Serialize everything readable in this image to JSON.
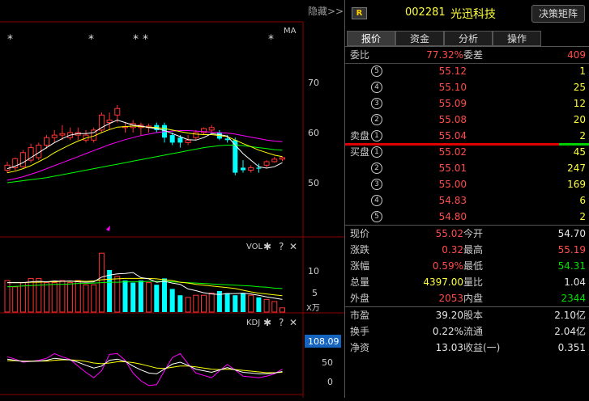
{
  "chart": {
    "hide_label": "隐藏",
    "hide_arrows": ">>",
    "ma_label": "MA",
    "price_ticks": [
      "70",
      "60",
      "50"
    ],
    "vol_label": "VOL",
    "vol_ticks": [
      "10",
      "5"
    ],
    "vol_unit": "X万",
    "kdj_label": "KDJ",
    "kdj_current": "108.09",
    "kdj_ticks": [
      "50",
      "0"
    ],
    "gear_glyph": "✱",
    "help_glyph": "?",
    "close_glyph": "✕",
    "star_glyph": "*",
    "colors": {
      "up": "#ff3333",
      "down": "#00ffff",
      "ma5": "#ffffff",
      "ma10": "#ffff00",
      "ma20": "#ff00ff",
      "ma60": "#00ff00"
    }
  },
  "chart_data": {
    "type": "candlestick",
    "price_ylim": [
      40,
      75
    ],
    "candles": [
      {
        "o": 52.5,
        "h": 54.2,
        "l": 52.0,
        "c": 53.5
      },
      {
        "o": 53.0,
        "h": 55.0,
        "l": 52.5,
        "c": 54.8
      },
      {
        "o": 53.2,
        "h": 56.5,
        "l": 53.0,
        "c": 56.0
      },
      {
        "o": 54.5,
        "h": 57.8,
        "l": 54.0,
        "c": 57.0
      },
      {
        "o": 55.0,
        "h": 58.0,
        "l": 54.5,
        "c": 57.5
      },
      {
        "o": 57.5,
        "h": 59.5,
        "l": 56.8,
        "c": 59.0
      },
      {
        "o": 59.0,
        "h": 60.5,
        "l": 58.0,
        "c": 59.5
      },
      {
        "o": 59.5,
        "h": 61.5,
        "l": 58.5,
        "c": 59.8
      },
      {
        "o": 59.0,
        "h": 61.0,
        "l": 58.5,
        "c": 60.0
      },
      {
        "o": 59.5,
        "h": 61.0,
        "l": 58.5,
        "c": 60.0
      },
      {
        "o": 58.5,
        "h": 60.5,
        "l": 58.0,
        "c": 59.5
      },
      {
        "o": 58.5,
        "h": 61.0,
        "l": 58.0,
        "c": 60.5
      },
      {
        "o": 60.5,
        "h": 64.0,
        "l": 60.0,
        "c": 63.5
      },
      {
        "o": 62.0,
        "h": 64.0,
        "l": 60.5,
        "c": 62.5
      },
      {
        "o": 63.5,
        "h": 65.5,
        "l": 62.0,
        "c": 64.8
      },
      {
        "o": 61.0,
        "h": 62.0,
        "l": 60.0,
        "c": 61.2
      },
      {
        "o": 61.0,
        "h": 62.5,
        "l": 60.0,
        "c": 61.8
      },
      {
        "o": 61.0,
        "h": 62.0,
        "l": 59.5,
        "c": 61.5
      },
      {
        "o": 61.0,
        "h": 61.8,
        "l": 60.0,
        "c": 61.3
      },
      {
        "o": 61.5,
        "h": 62.0,
        "l": 60.0,
        "c": 60.5
      },
      {
        "o": 61.5,
        "h": 62.0,
        "l": 58.0,
        "c": 59.0
      },
      {
        "o": 59.5,
        "h": 60.0,
        "l": 57.5,
        "c": 58.0
      },
      {
        "o": 59.0,
        "h": 59.5,
        "l": 57.0,
        "c": 58.0
      },
      {
        "o": 58.0,
        "h": 59.5,
        "l": 57.5,
        "c": 58.5
      },
      {
        "o": 59.0,
        "h": 60.5,
        "l": 58.5,
        "c": 60.0
      },
      {
        "o": 60.0,
        "h": 61.0,
        "l": 59.5,
        "c": 60.8
      },
      {
        "o": 60.5,
        "h": 61.5,
        "l": 60.0,
        "c": 61.0
      },
      {
        "o": 60.0,
        "h": 60.5,
        "l": 58.5,
        "c": 58.8
      },
      {
        "o": 58.8,
        "h": 59.5,
        "l": 58.0,
        "c": 58.5
      },
      {
        "o": 58.5,
        "h": 59.0,
        "l": 51.5,
        "c": 52.0
      },
      {
        "o": 53.0,
        "h": 54.5,
        "l": 52.0,
        "c": 52.5
      },
      {
        "o": 52.5,
        "h": 53.5,
        "l": 52.0,
        "c": 53.0
      },
      {
        "o": 53.0,
        "h": 53.8,
        "l": 52.0,
        "c": 52.8
      },
      {
        "o": 53.5,
        "h": 54.5,
        "l": 53.0,
        "c": 54.2
      },
      {
        "o": 54.2,
        "h": 55.2,
        "l": 54.0,
        "c": 54.7
      },
      {
        "o": 54.7,
        "h": 55.2,
        "l": 54.3,
        "c": 55.0
      }
    ],
    "ma5": [
      52.8,
      53.3,
      54.0,
      55.0,
      56.0,
      57.0,
      58.0,
      58.8,
      59.5,
      59.8,
      59.8,
      60.0,
      61.0,
      61.8,
      62.5,
      62.0,
      61.5,
      61.3,
      61.0,
      60.8,
      60.4,
      59.8,
      59.2,
      58.6,
      58.5,
      59.0,
      59.8,
      59.6,
      59.3,
      57.5,
      55.8,
      54.5,
      53.2,
      52.9,
      53.2,
      54.0
    ],
    "ma10": [
      52.0,
      52.3,
      52.8,
      53.4,
      54.2,
      55.0,
      56.0,
      56.8,
      57.6,
      58.3,
      58.9,
      59.3,
      60.0,
      60.6,
      61.1,
      61.2,
      61.3,
      61.2,
      61.1,
      61.0,
      60.8,
      60.5,
      60.2,
      59.9,
      59.7,
      59.6,
      59.6,
      59.4,
      59.2,
      58.5,
      57.8,
      57.2,
      56.5,
      56.0,
      55.5,
      55.2
    ],
    "ma20": [
      50.5,
      50.8,
      51.2,
      51.7,
      52.2,
      52.8,
      53.4,
      54.0,
      54.6,
      55.2,
      55.8,
      56.4,
      57.0,
      57.6,
      58.1,
      58.6,
      59.0,
      59.4,
      59.7,
      60.0,
      60.2,
      60.3,
      60.4,
      60.4,
      60.3,
      60.2,
      60.1,
      60.0,
      59.9,
      59.7,
      59.4,
      59.1,
      58.8,
      58.5,
      58.3,
      58.2
    ],
    "ma60": [
      50.0,
      50.2,
      50.4,
      50.6,
      50.8,
      51.0,
      51.3,
      51.6,
      51.9,
      52.2,
      52.5,
      52.8,
      53.1,
      53.4,
      53.7,
      54.0,
      54.3,
      54.6,
      54.9,
      55.2,
      55.5,
      55.8,
      56.1,
      56.4,
      56.7,
      57.0,
      57.2,
      57.4,
      57.5,
      57.5,
      57.4,
      57.2,
      57.0,
      56.8,
      56.6,
      56.5
    ],
    "volume_ylim": [
      0,
      15
    ],
    "volume": [
      7.5,
      6.0,
      7.0,
      8.0,
      8.0,
      7.0,
      7.0,
      7.5,
      7.0,
      7.5,
      6.5,
      6.5,
      14.0,
      10.0,
      8.5,
      7.5,
      7.0,
      7.5,
      7.0,
      6.5,
      8.0,
      5.5,
      4.0,
      3.5,
      4.0,
      4.0,
      4.5,
      5.0,
      4.5,
      4.0,
      4.5,
      4.0,
      3.5,
      3.0,
      2.5,
      1.0
    ],
    "volume_up": [
      true,
      true,
      true,
      true,
      true,
      true,
      true,
      true,
      true,
      true,
      true,
      true,
      true,
      false,
      true,
      false,
      false,
      false,
      true,
      false,
      false,
      false,
      false,
      true,
      true,
      true,
      true,
      false,
      false,
      false,
      false,
      true,
      false,
      true,
      true,
      true
    ],
    "vol_ma5": [
      7.0,
      7.0,
      7.0,
      7.2,
      7.3,
      7.2,
      7.4,
      7.3,
      7.4,
      7.2,
      7.1,
      7.2,
      8.3,
      8.8,
      9.1,
      9.2,
      9.4,
      8.2,
      7.9,
      7.1,
      7.3,
      6.9,
      6.6,
      5.5,
      5.1,
      4.6,
      4.3,
      4.2,
      4.4,
      4.4,
      4.5,
      4.3,
      4.0,
      3.6,
      3.3,
      3.0
    ],
    "vol_ma10": [
      7.0,
      7.0,
      7.0,
      7.1,
      7.1,
      7.2,
      7.2,
      7.3,
      7.3,
      7.4,
      7.3,
      7.4,
      7.7,
      7.8,
      7.9,
      8.0,
      8.0,
      8.0,
      8.0,
      7.9,
      7.7,
      7.5,
      7.1,
      6.9,
      6.6,
      6.4,
      6.2,
      6.0,
      5.8,
      5.6,
      5.2,
      4.8,
      4.5,
      4.3,
      4.1,
      3.9
    ],
    "vol_ma20": [
      6.0,
      6.1,
      6.2,
      6.3,
      6.4,
      6.5,
      6.6,
      6.6,
      6.7,
      6.8,
      6.8,
      6.9,
      7.0,
      7.1,
      7.1,
      7.2,
      7.2,
      7.2,
      7.3,
      7.3,
      7.3,
      7.2,
      7.1,
      7.0,
      6.9,
      6.8,
      6.7,
      6.6,
      6.5,
      6.4,
      6.3,
      6.2,
      6.0,
      5.9,
      5.7,
      5.6
    ],
    "kdj_ylim": [
      -10,
      115
    ],
    "kdj_k": [
      58,
      55,
      52,
      52,
      53,
      55,
      60,
      58,
      56,
      50,
      42,
      35,
      40,
      55,
      58,
      52,
      40,
      30,
      22,
      20,
      32,
      45,
      50,
      42,
      32,
      28,
      24,
      30,
      36,
      30,
      24,
      22,
      20,
      20,
      22,
      26
    ],
    "kdj_d": [
      54,
      54,
      53,
      53,
      53,
      53,
      55,
      56,
      56,
      55,
      52,
      48,
      46,
      48,
      51,
      51,
      49,
      45,
      40,
      35,
      34,
      37,
      40,
      40,
      38,
      35,
      32,
      31,
      32,
      31,
      29,
      27,
      25,
      23,
      23,
      24
    ],
    "kdj_j": [
      64,
      58,
      50,
      52,
      55,
      60,
      72,
      64,
      57,
      40,
      24,
      10,
      28,
      70,
      72,
      55,
      22,
      2,
      -10,
      -8,
      28,
      62,
      72,
      46,
      22,
      16,
      10,
      28,
      44,
      30,
      14,
      12,
      10,
      14,
      20,
      32
    ]
  },
  "quote": {
    "badge": "R",
    "code": "002281",
    "name": "光迅科技",
    "decision_button": "决策矩阵",
    "tabs": [
      "报价",
      "资金",
      "分析",
      "操作"
    ],
    "weibi_label": "委比",
    "weibi_value": "77.32%",
    "weicha_label": "委差",
    "weicha_value": "409",
    "sell_label": "卖盘",
    "buy_label": "买盘",
    "sell": [
      {
        "n": "5",
        "price": "55.12",
        "vol": "1"
      },
      {
        "n": "4",
        "price": "55.10",
        "vol": "25"
      },
      {
        "n": "3",
        "price": "55.09",
        "vol": "12"
      },
      {
        "n": "2",
        "price": "55.08",
        "vol": "20"
      },
      {
        "n": "1",
        "price": "55.04",
        "vol": "2"
      }
    ],
    "buy": [
      {
        "n": "1",
        "price": "55.02",
        "vol": "45"
      },
      {
        "n": "2",
        "price": "55.01",
        "vol": "247"
      },
      {
        "n": "3",
        "price": "55.00",
        "vol": "169"
      },
      {
        "n": "4",
        "price": "54.83",
        "vol": "6"
      },
      {
        "n": "5",
        "price": "54.80",
        "vol": "2"
      }
    ],
    "stats": [
      {
        "l1": "现价",
        "v1": "55.02",
        "c1": "red",
        "l2": "今开",
        "v2": "54.70",
        "c2": "white"
      },
      {
        "l1": "涨跌",
        "v1": "0.32",
        "c1": "red",
        "l2": "最高",
        "v2": "55.19",
        "c2": "red"
      },
      {
        "l1": "涨幅",
        "v1": "0.59%",
        "c1": "red",
        "l2": "最低",
        "v2": "54.31",
        "c2": "green"
      },
      {
        "l1": "总量",
        "v1": "4397.00",
        "c1": "yellow",
        "l2": "量比",
        "v2": "1.04",
        "c2": "white"
      },
      {
        "l1": "外盘",
        "v1": "2053",
        "c1": "red",
        "l2": "内盘",
        "v2": "2344",
        "c2": "green"
      }
    ],
    "stats2": [
      {
        "l1": "市盈",
        "v1": "39.20",
        "l2": "股本",
        "v2": "2.10亿"
      },
      {
        "l1": "换手",
        "v1": "0.22%",
        "l2": "流通",
        "v2": "2.04亿"
      },
      {
        "l1": "净资",
        "v1": "13.03",
        "l2": "收益(一)",
        "v2": "0.351"
      }
    ]
  }
}
